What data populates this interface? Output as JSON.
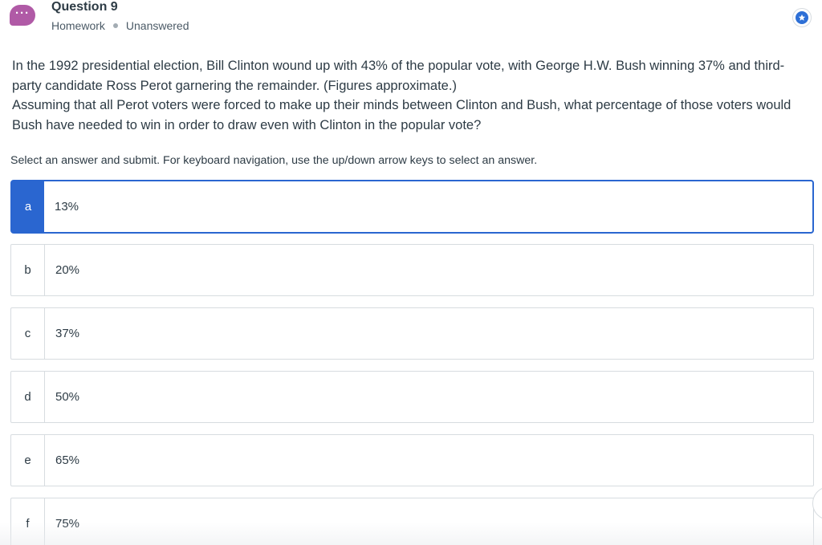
{
  "header": {
    "avatar_icon": "more-dots-icon",
    "title": "Question 9",
    "category": "Homework",
    "status": "Unanswered",
    "bookmark_icon": "star-icon",
    "accent": "#2a66d0",
    "avatar_color": "#b05aa6"
  },
  "question": {
    "paragraph1": "In the 1992 presidential election, Bill Clinton wound up with 43% of the popular vote, with George H.W. Bush winning 37% and third-party candidate Ross Perot garnering the remainder. (Figures approximate.)",
    "paragraph2": "Assuming that all Perot voters were forced to make up their minds between Clinton and Bush, what percentage of those voters would Bush have needed to win in order to draw even with Clinton in the popular vote?"
  },
  "instructions": "Select an answer and submit. For keyboard navigation, use the up/down arrow keys to select an answer.",
  "options": [
    {
      "letter": "a",
      "text": "13%",
      "selected": true
    },
    {
      "letter": "b",
      "text": "20%",
      "selected": false
    },
    {
      "letter": "c",
      "text": "37%",
      "selected": false
    },
    {
      "letter": "d",
      "text": "50%",
      "selected": false
    },
    {
      "letter": "e",
      "text": "65%",
      "selected": false
    },
    {
      "letter": "f",
      "text": "75%",
      "selected": false
    }
  ]
}
